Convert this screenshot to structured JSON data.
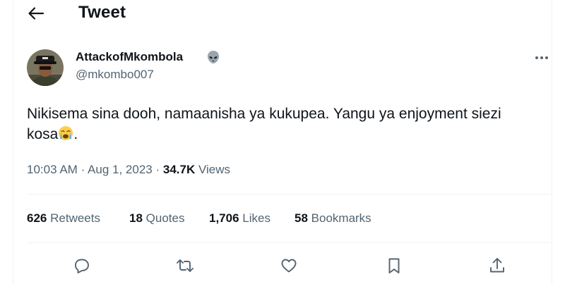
{
  "header": {
    "title": "Tweet"
  },
  "author": {
    "display_name": "AttackofMkombola",
    "handle": "@mkombo007"
  },
  "tweet": {
    "text_line1": "Nikisema sina dooh, namaanisha ya kukupea. Yangu ya enjoyment siezi",
    "text_line2_before": "kosa",
    "text_line2_after": "."
  },
  "meta": {
    "time": "10:03 AM",
    "separator": "·",
    "date": "Aug 1, 2023",
    "views_count": "34.7K",
    "views_label": "Views"
  },
  "stats": {
    "retweets": {
      "count": "626",
      "label": "Retweets"
    },
    "quotes": {
      "count": "18",
      "label": "Quotes"
    },
    "likes": {
      "count": "1,706",
      "label": "Likes"
    },
    "bookmarks": {
      "count": "58",
      "label": "Bookmarks"
    }
  },
  "icons": {
    "back": "arrow-left-icon",
    "more": "more-horizontal-icon",
    "reply": "reply-icon",
    "retweet": "retweet-icon",
    "like": "heart-icon",
    "bookmark": "bookmark-icon",
    "share": "share-icon"
  },
  "colors": {
    "text_primary": "#0f1419",
    "text_secondary": "#536471",
    "divider": "#eff3f4"
  }
}
